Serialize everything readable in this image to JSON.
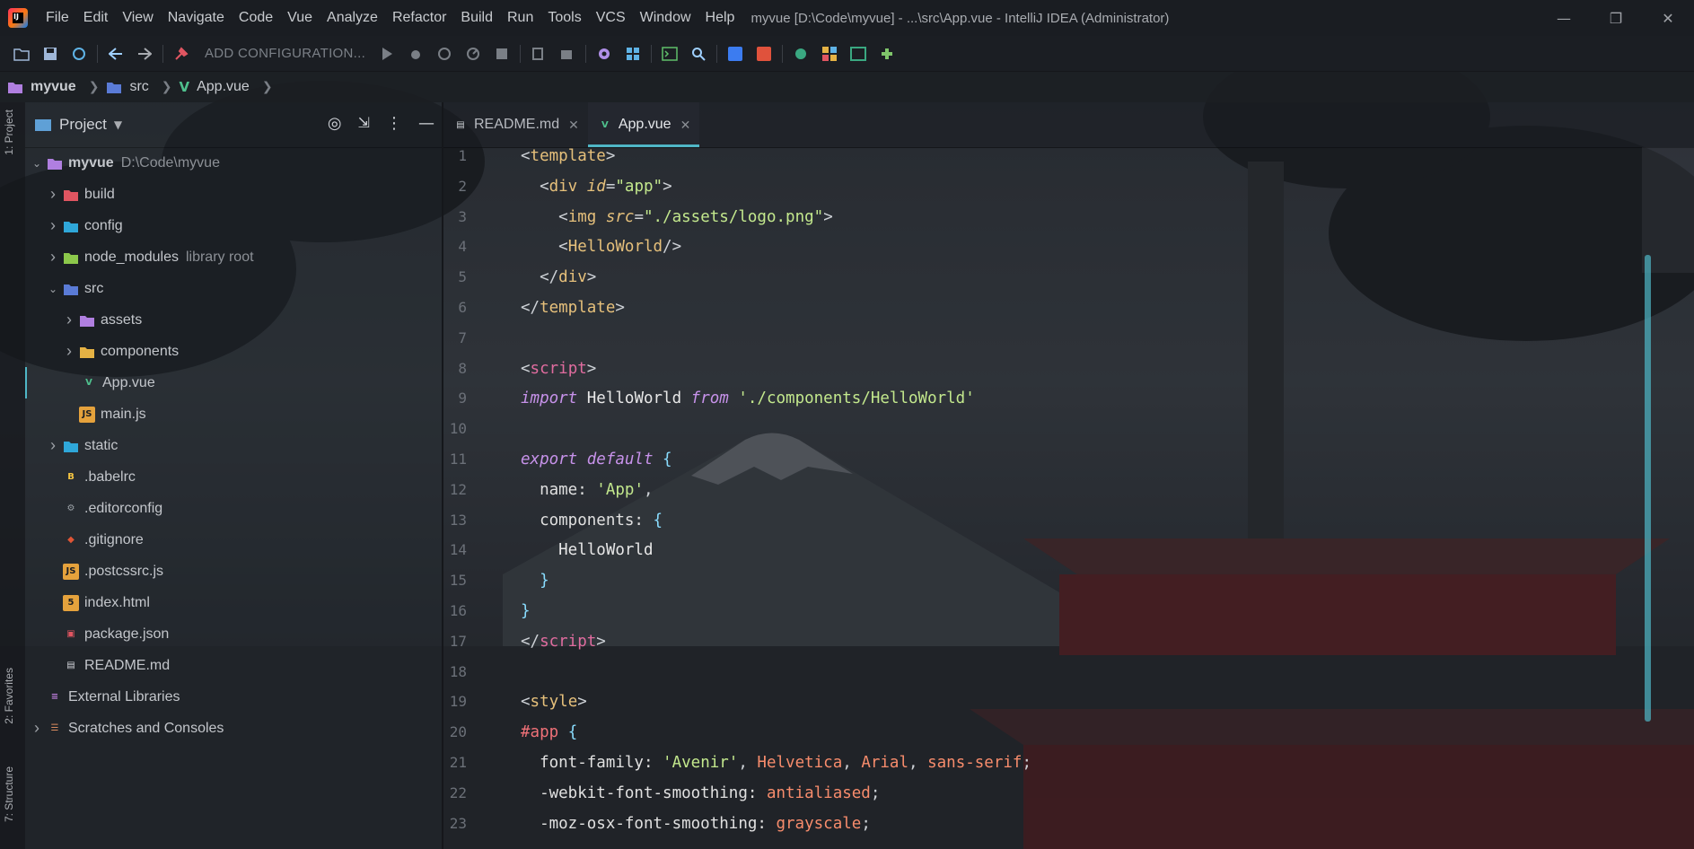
{
  "window": {
    "title": "myvue [D:\\Code\\myvue] - ...\\src\\App.vue - IntelliJ IDEA (Administrator)",
    "logo_text": "IJ"
  },
  "menu": [
    "File",
    "Edit",
    "View",
    "Navigate",
    "Code",
    "Vue",
    "Analyze",
    "Refactor",
    "Build",
    "Run",
    "Tools",
    "VCS",
    "Window",
    "Help"
  ],
  "toolbar": {
    "run_config_label": "ADD CONFIGURATION...",
    "icons": [
      "open-folder-icon",
      "save-icon",
      "sync-icon",
      "back-icon",
      "forward-icon",
      "build-hammer-icon",
      "run-icon",
      "debug-icon",
      "coverage-icon",
      "profile-icon",
      "stop-icon",
      "attach-icon",
      "ant-icon",
      "settings-icon",
      "project-structure-icon",
      "terminal-icon",
      "search-everywhere-icon",
      "translate-icon",
      "translate-alt-icon",
      "plugin-a-icon",
      "plugin-b-icon",
      "plugin-c-icon",
      "plugin-d-icon"
    ]
  },
  "breadcrumb": [
    "myvue",
    "src",
    "App.vue"
  ],
  "left_strip": {
    "project": "1: Project",
    "favorites": "2: Favorites",
    "structure": "7: Structure"
  },
  "project_panel": {
    "title": "Project",
    "tree": [
      {
        "depth": 0,
        "chevron": "down",
        "icon": "module-folder-icon",
        "label": "myvue",
        "hint": "D:\\Code\\myvue",
        "bold": true
      },
      {
        "depth": 1,
        "chevron": "right",
        "icon": "build-folder-icon",
        "label": "build"
      },
      {
        "depth": 1,
        "chevron": "right",
        "icon": "config-folder-icon",
        "label": "config"
      },
      {
        "depth": 1,
        "chevron": "right",
        "icon": "library-folder-icon",
        "label": "node_modules",
        "hint": "library root"
      },
      {
        "depth": 1,
        "chevron": "down",
        "icon": "source-folder-icon",
        "label": "src"
      },
      {
        "depth": 2,
        "chevron": "right",
        "icon": "resources-folder-icon",
        "label": "assets"
      },
      {
        "depth": 2,
        "chevron": "right",
        "icon": "components-folder-icon",
        "label": "components"
      },
      {
        "depth": 2,
        "chevron": "none",
        "icon": "vue-file-icon",
        "label": "App.vue",
        "selected": true
      },
      {
        "depth": 2,
        "chevron": "none",
        "icon": "js-file-icon",
        "label": "main.js"
      },
      {
        "depth": 1,
        "chevron": "right",
        "icon": "static-folder-icon",
        "label": "static"
      },
      {
        "depth": 1,
        "chevron": "none",
        "icon": "babel-file-icon",
        "label": ".babelrc"
      },
      {
        "depth": 1,
        "chevron": "none",
        "icon": "editorconfig-file-icon",
        "label": ".editorconfig"
      },
      {
        "depth": 1,
        "chevron": "none",
        "icon": "git-file-icon",
        "label": ".gitignore"
      },
      {
        "depth": 1,
        "chevron": "none",
        "icon": "js-file-icon",
        "label": ".postcssrc.js"
      },
      {
        "depth": 1,
        "chevron": "none",
        "icon": "html-file-icon",
        "label": "index.html"
      },
      {
        "depth": 1,
        "chevron": "none",
        "icon": "json-file-icon",
        "label": "package.json"
      },
      {
        "depth": 1,
        "chevron": "none",
        "icon": "markdown-file-icon",
        "label": "README.md"
      },
      {
        "depth": 0,
        "chevron": "none",
        "icon": "external-libraries-icon",
        "label": "External Libraries"
      },
      {
        "depth": 0,
        "chevron": "right",
        "icon": "scratches-icon",
        "label": "Scratches and Consoles"
      }
    ]
  },
  "editor": {
    "tabs": [
      {
        "label": "README.md",
        "icon": "markdown-file-icon",
        "active": false
      },
      {
        "label": "App.vue",
        "icon": "vue-file-icon",
        "active": true
      }
    ],
    "lines": [
      [
        [
          "t-pun",
          "<"
        ],
        [
          "t-tag",
          "template"
        ],
        [
          "t-pun",
          ">"
        ]
      ],
      [
        [
          "t-pun",
          "  <"
        ],
        [
          "t-tag",
          "div "
        ],
        [
          "t-at",
          "id"
        ],
        [
          "t-pun",
          "="
        ],
        [
          "t-str",
          "\"app\""
        ],
        [
          "t-pun",
          ">"
        ]
      ],
      [
        [
          "t-pun",
          "    <"
        ],
        [
          "t-tag",
          "img "
        ],
        [
          "t-at",
          "src"
        ],
        [
          "t-pun",
          "="
        ],
        [
          "t-str",
          "\"./assets/logo.png\""
        ],
        [
          "t-pun",
          ">"
        ]
      ],
      [
        [
          "t-pun",
          "    <"
        ],
        [
          "t-tag",
          "HelloWorld"
        ],
        [
          "t-pun",
          "/>"
        ]
      ],
      [
        [
          "t-pun",
          "  </"
        ],
        [
          "t-tag",
          "div"
        ],
        [
          "t-pun",
          ">"
        ]
      ],
      [
        [
          "t-pun",
          "</"
        ],
        [
          "t-tag",
          "template"
        ],
        [
          "t-pun",
          ">"
        ]
      ],
      [],
      [
        [
          "t-pun",
          "<"
        ],
        [
          "t-tn",
          "script"
        ],
        [
          "t-pun",
          ">"
        ]
      ],
      [
        [
          "t-kw",
          "import "
        ],
        [
          "t-id",
          "HelloWorld "
        ],
        [
          "t-kw",
          "from "
        ],
        [
          "t-str",
          "'./components/HelloWorld'"
        ]
      ],
      [],
      [
        [
          "t-kw",
          "export default "
        ],
        [
          "t-brace",
          "{"
        ]
      ],
      [
        [
          "t-prop",
          "  name: "
        ],
        [
          "t-str",
          "'App'"
        ],
        [
          "t-pun",
          ","
        ]
      ],
      [
        [
          "t-prop",
          "  components: "
        ],
        [
          "t-brace",
          "{"
        ]
      ],
      [
        [
          "t-id",
          "    HelloWorld"
        ]
      ],
      [
        [
          "t-brace",
          "  }"
        ]
      ],
      [
        [
          "t-brace",
          "}"
        ]
      ],
      [
        [
          "t-pun",
          "</"
        ],
        [
          "t-tn",
          "script"
        ],
        [
          "t-pun",
          ">"
        ]
      ],
      [],
      [
        [
          "t-pun",
          "<"
        ],
        [
          "t-tag",
          "style"
        ],
        [
          "t-pun",
          ">"
        ]
      ],
      [
        [
          "t-sel",
          "#app "
        ],
        [
          "t-brace",
          "{"
        ]
      ],
      [
        [
          "t-prop",
          "  font-family: "
        ],
        [
          "t-str",
          "'Avenir'"
        ],
        [
          "t-pun",
          ", "
        ],
        [
          "t-val",
          "Helvetica"
        ],
        [
          "t-pun",
          ", "
        ],
        [
          "t-val",
          "Arial"
        ],
        [
          "t-pun",
          ", "
        ],
        [
          "t-val",
          "sans-serif"
        ],
        [
          "t-pun",
          ";"
        ]
      ],
      [
        [
          "t-prop",
          "  -webkit-font-smoothing: "
        ],
        [
          "t-val",
          "antialiased"
        ],
        [
          "t-pun",
          ";"
        ]
      ],
      [
        [
          "t-prop",
          "  -moz-osx-font-smoothing: "
        ],
        [
          "t-val",
          "grayscale"
        ],
        [
          "t-pun",
          ";"
        ]
      ]
    ]
  },
  "colors": {
    "accent": "#4fb6c6",
    "tag": "#e6c07b",
    "string": "#c3e88d",
    "keyword": "#c792ea"
  }
}
